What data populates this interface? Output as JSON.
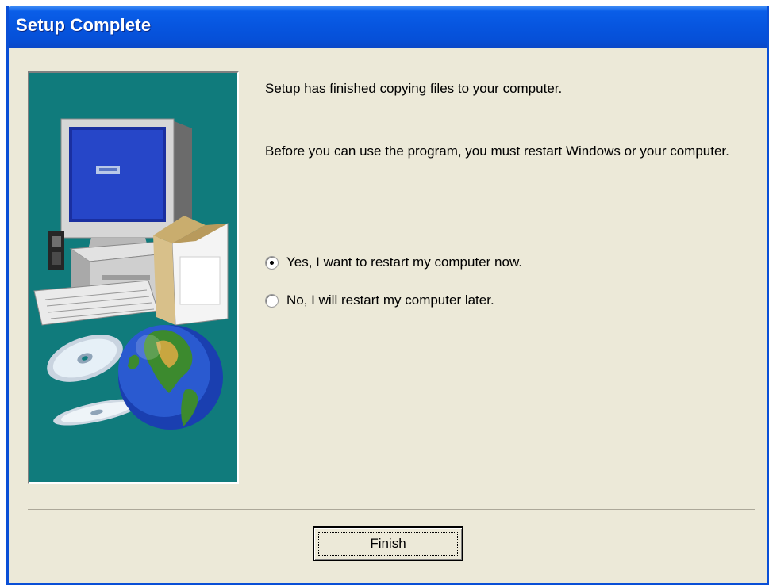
{
  "window": {
    "title": "Setup Complete"
  },
  "message": {
    "line1": "Setup has finished copying files to your computer.",
    "line2": "Before you can use the program, you must restart Windows or your computer."
  },
  "options": [
    {
      "label": "Yes, I want to restart my computer now.",
      "selected": true
    },
    {
      "label": "No, I will restart my computer later.",
      "selected": false
    }
  ],
  "buttons": {
    "finish_label": "Finish"
  },
  "graphic": {
    "icons": [
      "computer-icon",
      "cd-icon",
      "globe-icon"
    ]
  },
  "colors": {
    "titlebar": "#0756e0",
    "dialog_bg": "#ece9d8",
    "graphic_bg": "#107b7c"
  }
}
